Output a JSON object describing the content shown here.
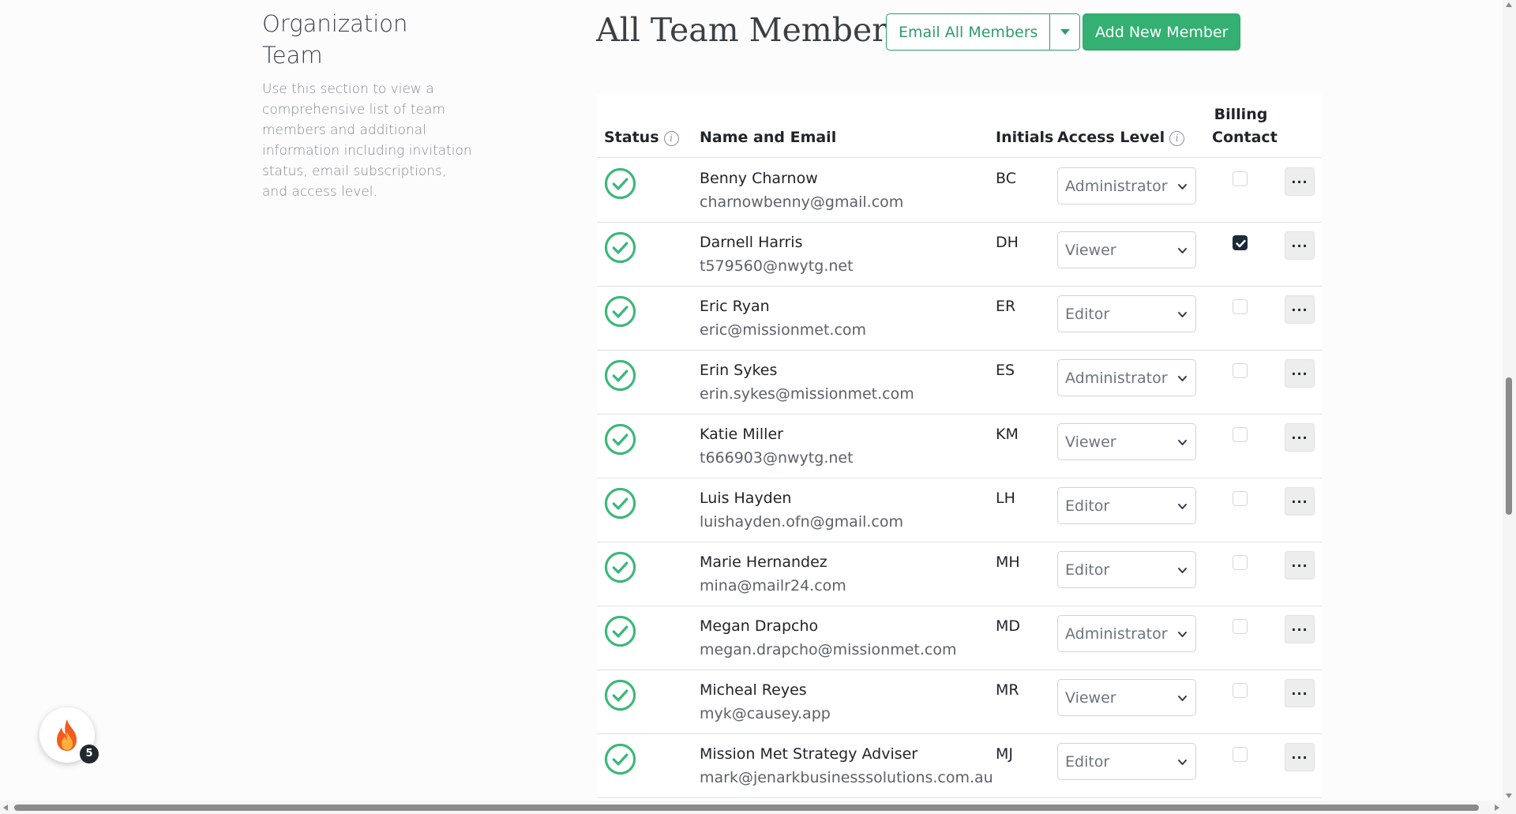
{
  "intro": {
    "title": "Organization Team",
    "description": "Use this section to view a comprehensive list of team members and additional information including invitation status, email subscriptions, and access level."
  },
  "header": {
    "title": "All Team Members",
    "email_all_label": "Email All Members",
    "add_member_label": "Add New Member"
  },
  "table": {
    "columns": {
      "status": "Status",
      "name_email": "Name and Email",
      "initials": "Initials",
      "access_level": "Access Level",
      "billing_line1": "Billing",
      "billing_line2": "Contact"
    },
    "rows": [
      {
        "name": "Benny Charnow",
        "email": "charnowbenny@gmail.com",
        "initials": "BC",
        "access": "Administrator",
        "billing": false
      },
      {
        "name": "Darnell Harris",
        "email": "t579560@nwytg.net",
        "initials": "DH",
        "access": "Viewer",
        "billing": true
      },
      {
        "name": "Eric Ryan",
        "email": "eric@missionmet.com",
        "initials": "ER",
        "access": "Editor",
        "billing": false
      },
      {
        "name": "Erin Sykes",
        "email": "erin.sykes@missionmet.com",
        "initials": "ES",
        "access": "Administrator",
        "billing": false
      },
      {
        "name": "Katie Miller",
        "email": "t666903@nwytg.net",
        "initials": "KM",
        "access": "Viewer",
        "billing": false
      },
      {
        "name": "Luis Hayden",
        "email": "luishayden.ofn@gmail.com",
        "initials": "LH",
        "access": "Editor",
        "billing": false
      },
      {
        "name": "Marie Hernandez",
        "email": "mina@mailr24.com",
        "initials": "MH",
        "access": "Editor",
        "billing": false
      },
      {
        "name": "Megan Drapcho",
        "email": "megan.drapcho@missionmet.com",
        "initials": "MD",
        "access": "Administrator",
        "billing": false
      },
      {
        "name": "Micheal Reyes",
        "email": "myk@causey.app",
        "initials": "MR",
        "access": "Viewer",
        "billing": false
      },
      {
        "name": "Mission Met Strategy Adviser",
        "email": "mark@jenarkbusinesssolutions.com.au",
        "initials": "MJ",
        "access": "Editor",
        "billing": false
      }
    ],
    "more_label": "···"
  },
  "fab": {
    "icon": "fire-icon",
    "badge": "5"
  },
  "colors": {
    "accent": "#2d9c6a",
    "primary": "#33b072",
    "status_ok": "#3cb878",
    "checked": "#1c2b3b"
  }
}
